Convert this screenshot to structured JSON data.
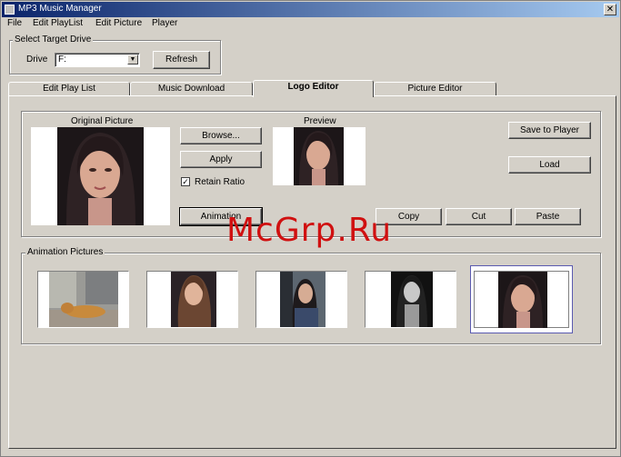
{
  "window": {
    "title": "MP3 Music Manager",
    "close_label": "✕"
  },
  "menu": {
    "items": [
      "File",
      "Edit PlayList",
      "Edit Picture",
      "Player"
    ]
  },
  "drive": {
    "group_label": "Select Target Drive",
    "drive_label": "Drive",
    "selected": "F:",
    "refresh_label": "Refresh"
  },
  "tabs": [
    {
      "label": "Edit Play List",
      "active": false
    },
    {
      "label": "Music Download",
      "active": false
    },
    {
      "label": "Logo Editor",
      "active": true
    },
    {
      "label": "Picture Editor",
      "active": false
    }
  ],
  "logo_editor": {
    "original_label": "Original Picture",
    "preview_label": "Preview",
    "browse_label": "Browse...",
    "apply_label": "Apply",
    "retain_ratio_label": "Retain Ratio",
    "retain_ratio_checked": true,
    "animation_label": "Animation",
    "save_label": "Save to Player",
    "load_label": "Load",
    "copy_label": "Copy",
    "cut_label": "Cut",
    "paste_label": "Paste"
  },
  "animation": {
    "group_label": "Animation Pictures",
    "thumbnails": [
      {
        "icon": "street-dog-photo",
        "selected": false
      },
      {
        "icon": "woman-portrait-photo",
        "selected": false
      },
      {
        "icon": "woman-street-photo",
        "selected": false
      },
      {
        "icon": "woman-bw-photo",
        "selected": false
      },
      {
        "icon": "woman-closeup-photo",
        "selected": true
      }
    ]
  },
  "watermark": "McGrp.Ru",
  "colors": {
    "face_bg": "#d4d0c8",
    "title_start": "#0a246a",
    "title_end": "#a6caf0",
    "watermark": "#d01010"
  }
}
